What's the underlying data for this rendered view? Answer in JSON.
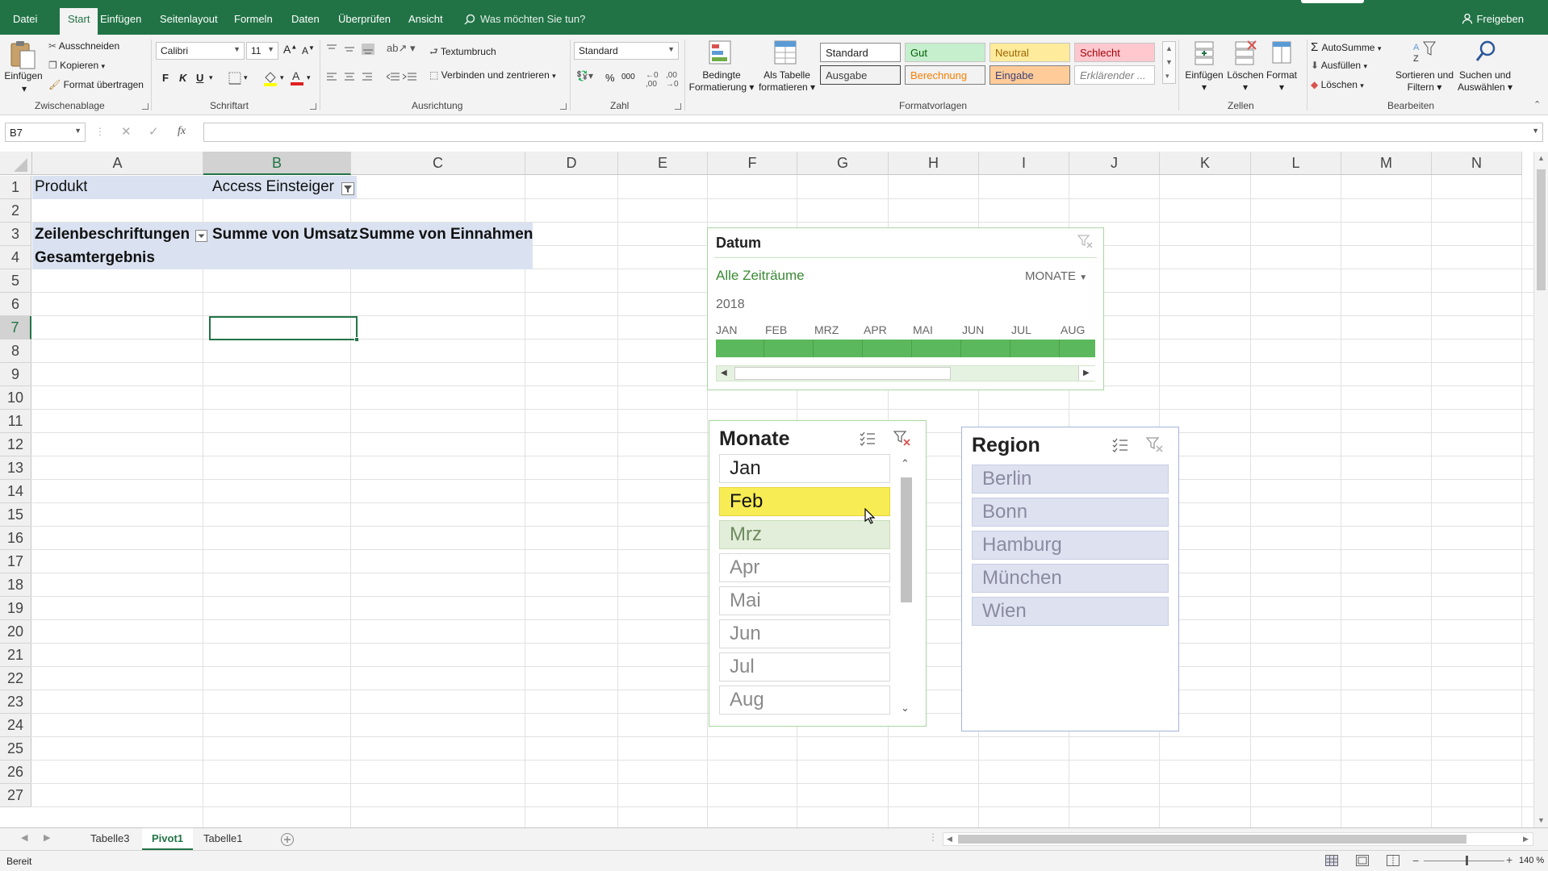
{
  "ribbon_tabs": [
    "Datei",
    "Start",
    "Einfügen",
    "Seitenlayout",
    "Formeln",
    "Daten",
    "Überprüfen",
    "Ansicht"
  ],
  "tell_me": "Was möchten Sie tun?",
  "share": "Freigeben",
  "clipboard": {
    "paste": "Einfügen",
    "cut": "Ausschneiden",
    "copy": "Kopieren",
    "format_painter": "Format übertragen",
    "group": "Zwischenablage"
  },
  "font": {
    "name": "Calibri",
    "size": "11",
    "bold": "F",
    "italic": "K",
    "underline": "U",
    "group": "Schriftart"
  },
  "alignment": {
    "wrap": "Textumbruch",
    "merge": "Verbinden und zentrieren",
    "group": "Ausrichtung"
  },
  "number": {
    "format": "Standard",
    "percent": "%",
    "thousands": "000",
    "group": "Zahl"
  },
  "styles": {
    "cond_format_1": "Bedingte",
    "cond_format_2": "Formatierung",
    "as_table_1": "Als Tabelle",
    "as_table_2": "formatieren",
    "cells": [
      "Standard",
      "Gut",
      "Neutral",
      "Schlecht",
      "Ausgabe",
      "Berechnung",
      "Eingabe",
      "Erklärender ..."
    ],
    "group": "Formatvorlagen"
  },
  "cells_group": {
    "insert": "Einfügen",
    "delete": "Löschen",
    "format": "Format",
    "group": "Zellen"
  },
  "editing": {
    "autosum": "AutoSumme",
    "fill": "Ausfüllen",
    "clear": "Löschen",
    "sort_1": "Sortieren und",
    "sort_2": "Filtern",
    "find_1": "Suchen und",
    "find_2": "Auswählen",
    "group": "Bearbeiten"
  },
  "namebox": "B7",
  "fx": "fx",
  "columns": [
    "A",
    "B",
    "C",
    "D",
    "E",
    "F",
    "G",
    "H",
    "I",
    "J",
    "K",
    "L",
    "M",
    "N"
  ],
  "rows": [
    "1",
    "2",
    "3",
    "4",
    "5",
    "6",
    "7",
    "8",
    "9",
    "10",
    "11",
    "12",
    "13",
    "14",
    "15",
    "16",
    "17",
    "18",
    "19",
    "20",
    "21",
    "22",
    "23",
    "24",
    "25",
    "26",
    "27"
  ],
  "pivot": {
    "filter_label": "Produkt",
    "filter_value": "Access Einsteiger",
    "row_labels": "Zeilenbeschriftungen",
    "sum_revenue": "Summe von Umsatz",
    "sum_income": "Summe von Einnahmen",
    "grand_total": "Gesamtergebnis"
  },
  "timeline": {
    "title": "Datum",
    "period": "Alle Zeiträume",
    "level": "MONATE",
    "year": "2018",
    "months": [
      "JAN",
      "FEB",
      "MRZ",
      "APR",
      "MAI",
      "JUN",
      "JUL",
      "AUG"
    ]
  },
  "slicer_monate": {
    "title": "Monate",
    "items": [
      "Jan",
      "Feb",
      "Mrz",
      "Apr",
      "Mai",
      "Jun",
      "Jul",
      "Aug"
    ]
  },
  "slicer_region": {
    "title": "Region",
    "items": [
      "Berlin",
      "Bonn",
      "Hamburg",
      "München",
      "Wien"
    ]
  },
  "sheets": [
    "Tabelle3",
    "Pivot1",
    "Tabelle1"
  ],
  "status": "Bereit",
  "zoom": "140 %",
  "colors": {
    "excel_green": "#217346",
    "pivot_band": "#dae2f1",
    "slicer_selected": "#f7ec54",
    "timeline_bar": "#5cb85c"
  }
}
